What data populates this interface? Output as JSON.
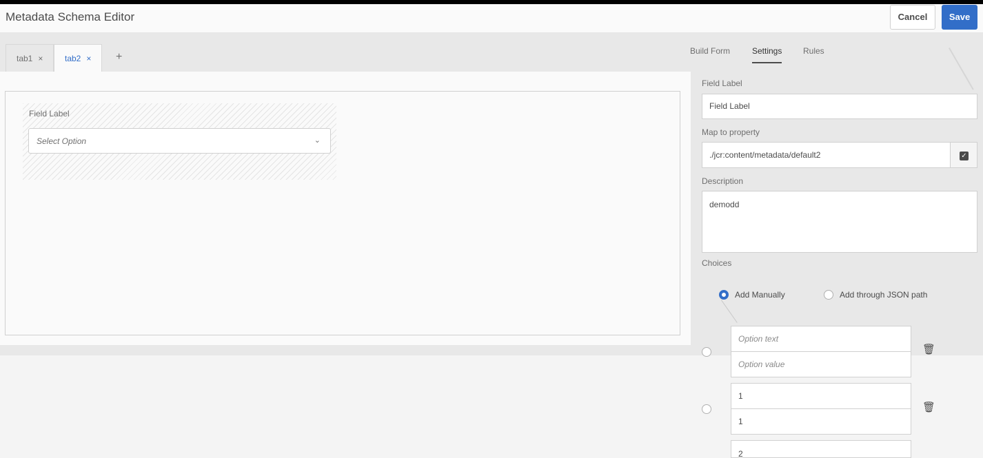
{
  "header": {
    "title": "Metadata Schema Editor",
    "cancel_label": "Cancel",
    "save_label": "Save"
  },
  "tabs": [
    {
      "label": "tab1",
      "close": "×"
    },
    {
      "label": "tab2",
      "close": "×"
    }
  ],
  "add_tab": "+",
  "canvas": {
    "field_label": "Field Label",
    "select_placeholder": "Select Option",
    "select_chevron": "⌄"
  },
  "side_tabs": [
    "Build Form",
    "Settings",
    "Rules"
  ],
  "settings": {
    "field_label_label": "Field Label",
    "field_label_value": "Field Label",
    "map_label": "Map to property",
    "map_value": "./jcr:content/metadata/default2",
    "description_label": "Description",
    "description_value": "demodd",
    "choices_label": "Choices",
    "radio_manual": "Add Manually",
    "radio_json": "Add through JSON path",
    "options": [
      {
        "text_placeholder": "Option text",
        "value_placeholder": "Option value"
      },
      {
        "text": "1",
        "value": "1"
      },
      {
        "text": "2"
      }
    ],
    "trash_icon": "🗑"
  },
  "colors": {
    "accent": "#326ec8"
  }
}
